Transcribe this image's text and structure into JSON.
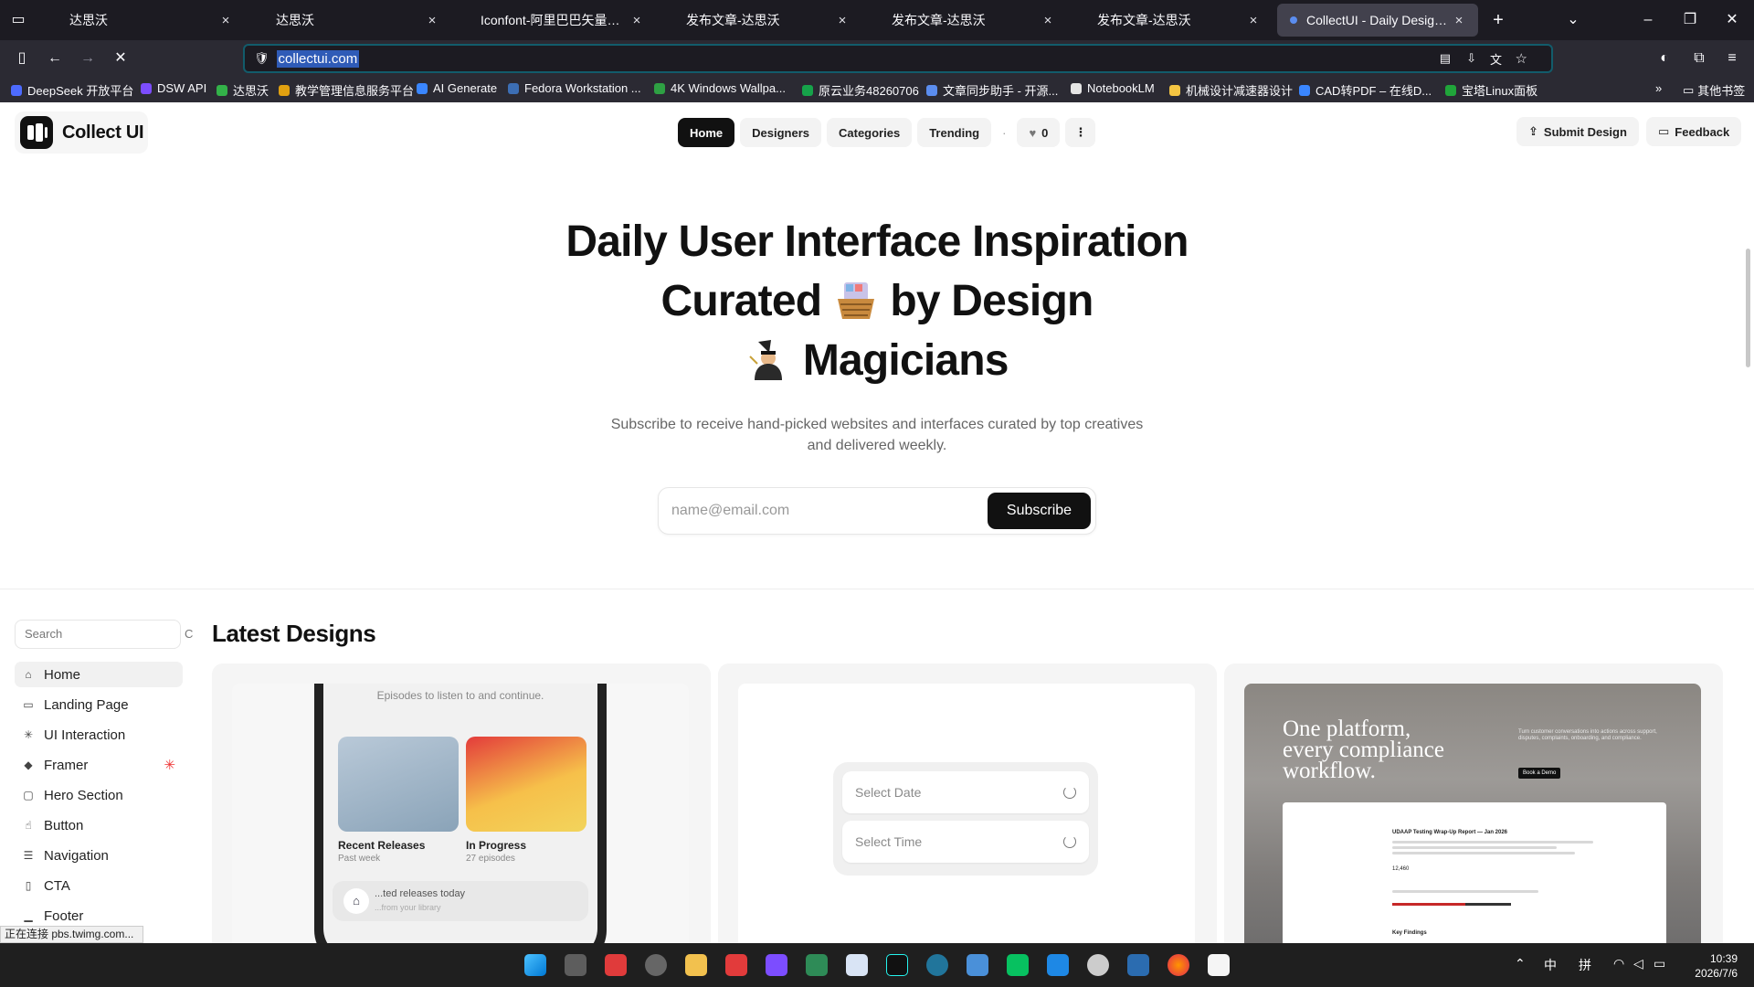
{
  "browser": {
    "tabs": [
      {
        "label": "达思沃"
      },
      {
        "label": "达思沃"
      },
      {
        "label": "Iconfont-阿里巴巴矢量图标库 国内海量免费"
      },
      {
        "label": "发布文章-达思沃"
      },
      {
        "label": "发布文章-达思沃"
      },
      {
        "label": "发布文章-达思沃"
      },
      {
        "label": "CollectUI - Daily Design Inspiration"
      }
    ],
    "close_glyph": "×",
    "new_tab_glyph": "+",
    "url": "collectui.com",
    "bookmarks": [
      {
        "label": "DeepSeek 开放平台",
        "color": "#4d6bfe"
      },
      {
        "label": "DSW API",
        "color": "#7c4dff"
      },
      {
        "label": "达思沃",
        "color": "#33b249"
      },
      {
        "label": "教学管理信息服务平台",
        "color": "#e0a010"
      },
      {
        "label": "AI Generate",
        "color": "#3a86ff"
      },
      {
        "label": "Fedora Workstation ...",
        "color": "#3c6eb4"
      },
      {
        "label": "4K Windows Wallpa...",
        "color": "#2ea043"
      },
      {
        "label": "原云业务48260706",
        "color": "#16a34a"
      },
      {
        "label": "文章同步助手 - 开源...",
        "color": "#5b8def"
      },
      {
        "label": "NotebookLM",
        "color": "#e5e5e5"
      },
      {
        "label": "机械设计减速器设计",
        "color": "#f4c542"
      },
      {
        "label": "CAD转PDF – 在线D...",
        "color": "#3a86ff"
      },
      {
        "label": "宝塔Linux面板",
        "color": "#20a53a"
      }
    ],
    "other_bookmarks": "其他书签",
    "status_text": "正在连接 pbs.twimg.com..."
  },
  "site": {
    "logo_text": "Collect UI",
    "nav": [
      "Home",
      "Designers",
      "Categories",
      "Trending"
    ],
    "nav_separator": "·",
    "likes_count": "0",
    "submit_label": "Submit Design",
    "feedback_label": "Feedback"
  },
  "hero": {
    "line1": "Daily User Interface Inspiration",
    "line2_a": "Curated",
    "line2_b": "by Design",
    "line3": "Magicians",
    "subtitle": "Subscribe to receive hand-picked websites and interfaces curated by top creatives and delivered weekly.",
    "email_placeholder": "name@email.com",
    "subscribe_label": "Subscribe"
  },
  "sidebar": {
    "search_placeholder": "Search",
    "search_suffix": "C",
    "items": [
      {
        "label": "Home",
        "icon": "home-icon"
      },
      {
        "label": "Landing Page",
        "icon": "monitor-icon"
      },
      {
        "label": "UI Interaction",
        "icon": "sparkle-icon"
      },
      {
        "label": "Framer",
        "icon": "framer-icon"
      },
      {
        "label": "Hero Section",
        "icon": "hero-icon"
      },
      {
        "label": "Button",
        "icon": "pointer-icon"
      },
      {
        "label": "Navigation",
        "icon": "navigation-icon"
      },
      {
        "label": "CTA",
        "icon": "phone-icon"
      },
      {
        "label": "Footer",
        "icon": "footer-icon"
      }
    ]
  },
  "latest": {
    "title": "Latest Designs",
    "card1": {
      "caption": "Episodes to listen to and continue.",
      "album1_title": "Recent Releases",
      "album1_sub": "Past week",
      "album2_title": "In Progress",
      "album2_sub": "27 episodes",
      "bar_text": "...ted releases today",
      "bar_sub": "...from your library"
    },
    "card2": {
      "date_label": "Select Date",
      "time_label": "Select Time"
    },
    "card3": {
      "headline_1": "One platform,",
      "headline_2": "every compliance",
      "headline_3": "workflow.",
      "side_text": "Turn customer conversations into actions across support, disputes, complaints, onboarding, and compliance.",
      "side_button": "Book a Demo",
      "doc_title": "UDAAP Testing Wrap-Up Report — Jan 2026",
      "doc_stat": "12,460",
      "doc_section": "Key Findings"
    }
  },
  "taskbar": {
    "time": "10:39",
    "date": "2026/7/6",
    "ime_1": "中",
    "ime_2": "拼"
  }
}
